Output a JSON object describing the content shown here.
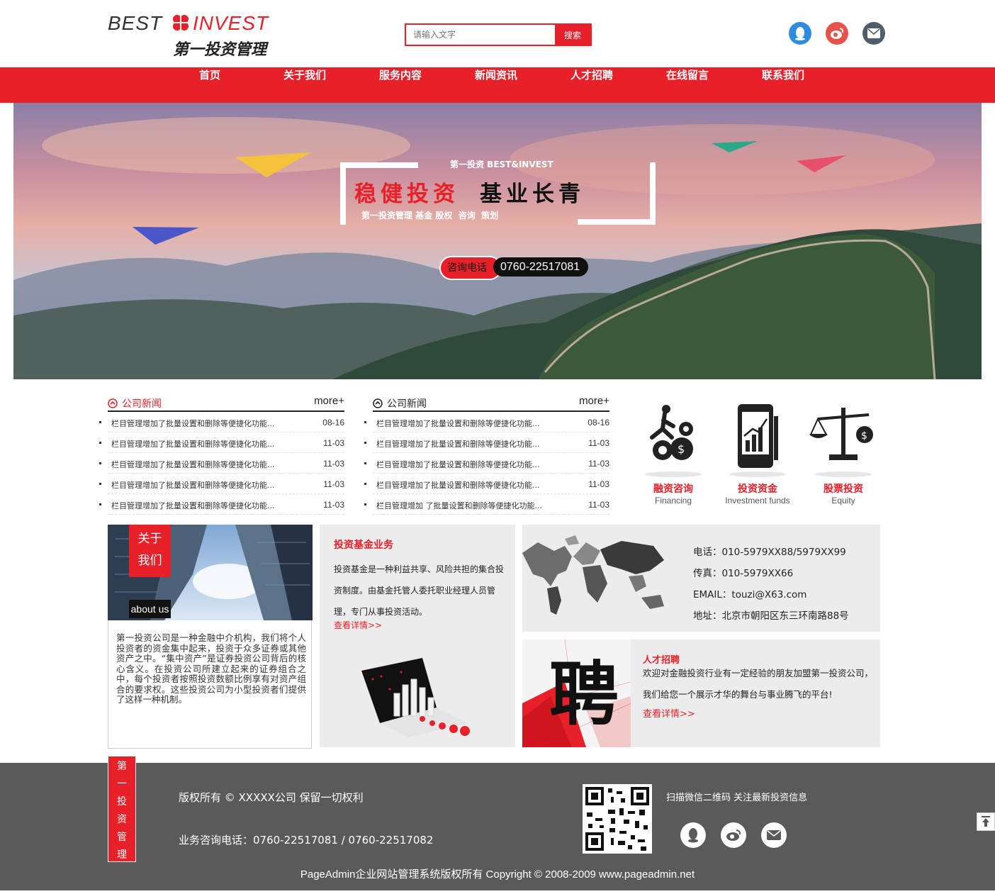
{
  "header": {
    "logo_left": "BEST",
    "logo_right": "INVEST",
    "logo_cn": "第一投资管理",
    "search_placeholder": "请输入文字",
    "search_button": "搜索"
  },
  "nav": [
    "首页",
    "关于我们",
    "服务内容",
    "新闻资讯",
    "人才招聘",
    "在线留言",
    "联系我们"
  ],
  "banner": {
    "tagline": "第一投资 BEST&INVEST",
    "headline_red": "稳健投资",
    "headline_black": "基业长青",
    "subline": "第一投资管理 基金 股权  咨询  策划",
    "hotline_label": "咨询电话",
    "hotline_number": "0760-22517081"
  },
  "news_left": {
    "title": "公司新闻",
    "more": "more+",
    "items": [
      {
        "text": "栏目管理增加了批量设置和删除等便捷化功能...",
        "date": "08-16"
      },
      {
        "text": "栏目管理增加了批量设置和删除等便捷化功能...",
        "date": "11-03"
      },
      {
        "text": "栏目管理增加了批量设置和删除等便捷化功能...",
        "date": "11-03"
      },
      {
        "text": "栏目管理增加了批量设置和删除等便捷化功能...",
        "date": "11-03"
      },
      {
        "text": "栏目管理增加了批量设置和删除等便捷化功能...",
        "date": "11-03"
      }
    ]
  },
  "news_right": {
    "title": "公司新闻",
    "more": "more+",
    "items": [
      {
        "text": "栏目管理增加了批量设置和删除等便捷化功能...",
        "date": "08-16"
      },
      {
        "text": "栏目管理增加了批量设置和删除等便捷化功能...",
        "date": "11-03"
      },
      {
        "text": "栏目管理增加了批量设置和删除等便捷化功能...",
        "date": "11-03"
      },
      {
        "text": "栏目管理增加了批量设置和删除等便捷化功能...",
        "date": "11-03"
      },
      {
        "text": "栏目管理增加 了批量设置和删除等便捷化功能...",
        "date": "11-03"
      }
    ]
  },
  "services": [
    {
      "title": "融资咨询",
      "sub": "Financing",
      "icon": "gears-climber-icon"
    },
    {
      "title": "投资资金",
      "sub": "Investment funds",
      "icon": "phone-chart-icon"
    },
    {
      "title": "股票投资",
      "sub": "Equity",
      "icon": "scales-icon"
    }
  ],
  "about": {
    "label_line1": "关于",
    "label_line2": "我们",
    "label_en": "about us",
    "text": "第一投资公司是一种金融中介机构，我们将个人投资者的资金集中起来，投资于众多证券或其他资产之中。“集中资产”是证券投资公司背后的核心含义。在投资公司所建立起来的证券组合之中，每个投资者按照投资数额比例享有对资产组合的要求权。这些投资公司为小型投资者们提供了这样一种机制。"
  },
  "fund": {
    "title": "投资基金业务",
    "text": "投资基金是一种利益共享、风险共担的集合投资制度。由基金托管人委托职业经理人员管理，专门从事投资活动。",
    "link": "查看详情>>"
  },
  "contact": {
    "phone": "电话：010-5979XX88/5979XX99",
    "fax": "传真：010-5979XX66",
    "email": "EMAIL：touzi@X63.com",
    "address": "地址：北京市朝阳区东三环南路88号"
  },
  "recruit": {
    "title": "人才招聘",
    "text": "欢迎对金融投资行业有一定经验的朋友加盟第一投资公司，我们给您一个展示才华的舞台与事业腾飞的平台!",
    "link": "查看详情>>",
    "glyph": "聘"
  },
  "footer": {
    "vertical_label": [
      "第",
      "一",
      "投",
      "资",
      "管",
      "理"
    ],
    "copyright": "版权所有 © XXXXX公司 保留一切权利",
    "hotline": "业务咨询电话：0760-22517081 / 0760-22517082",
    "qr_text": "扫描微信二维码 关注最新投资信息",
    "bottom": "PageAdmin企业网站管理系统版权所有 Copyright © 2008-2009 www.pageadmin.net"
  },
  "colors": {
    "accent": "#e8202a",
    "footer_bg": "#5a5a5a",
    "panel_bg": "#ececec"
  }
}
